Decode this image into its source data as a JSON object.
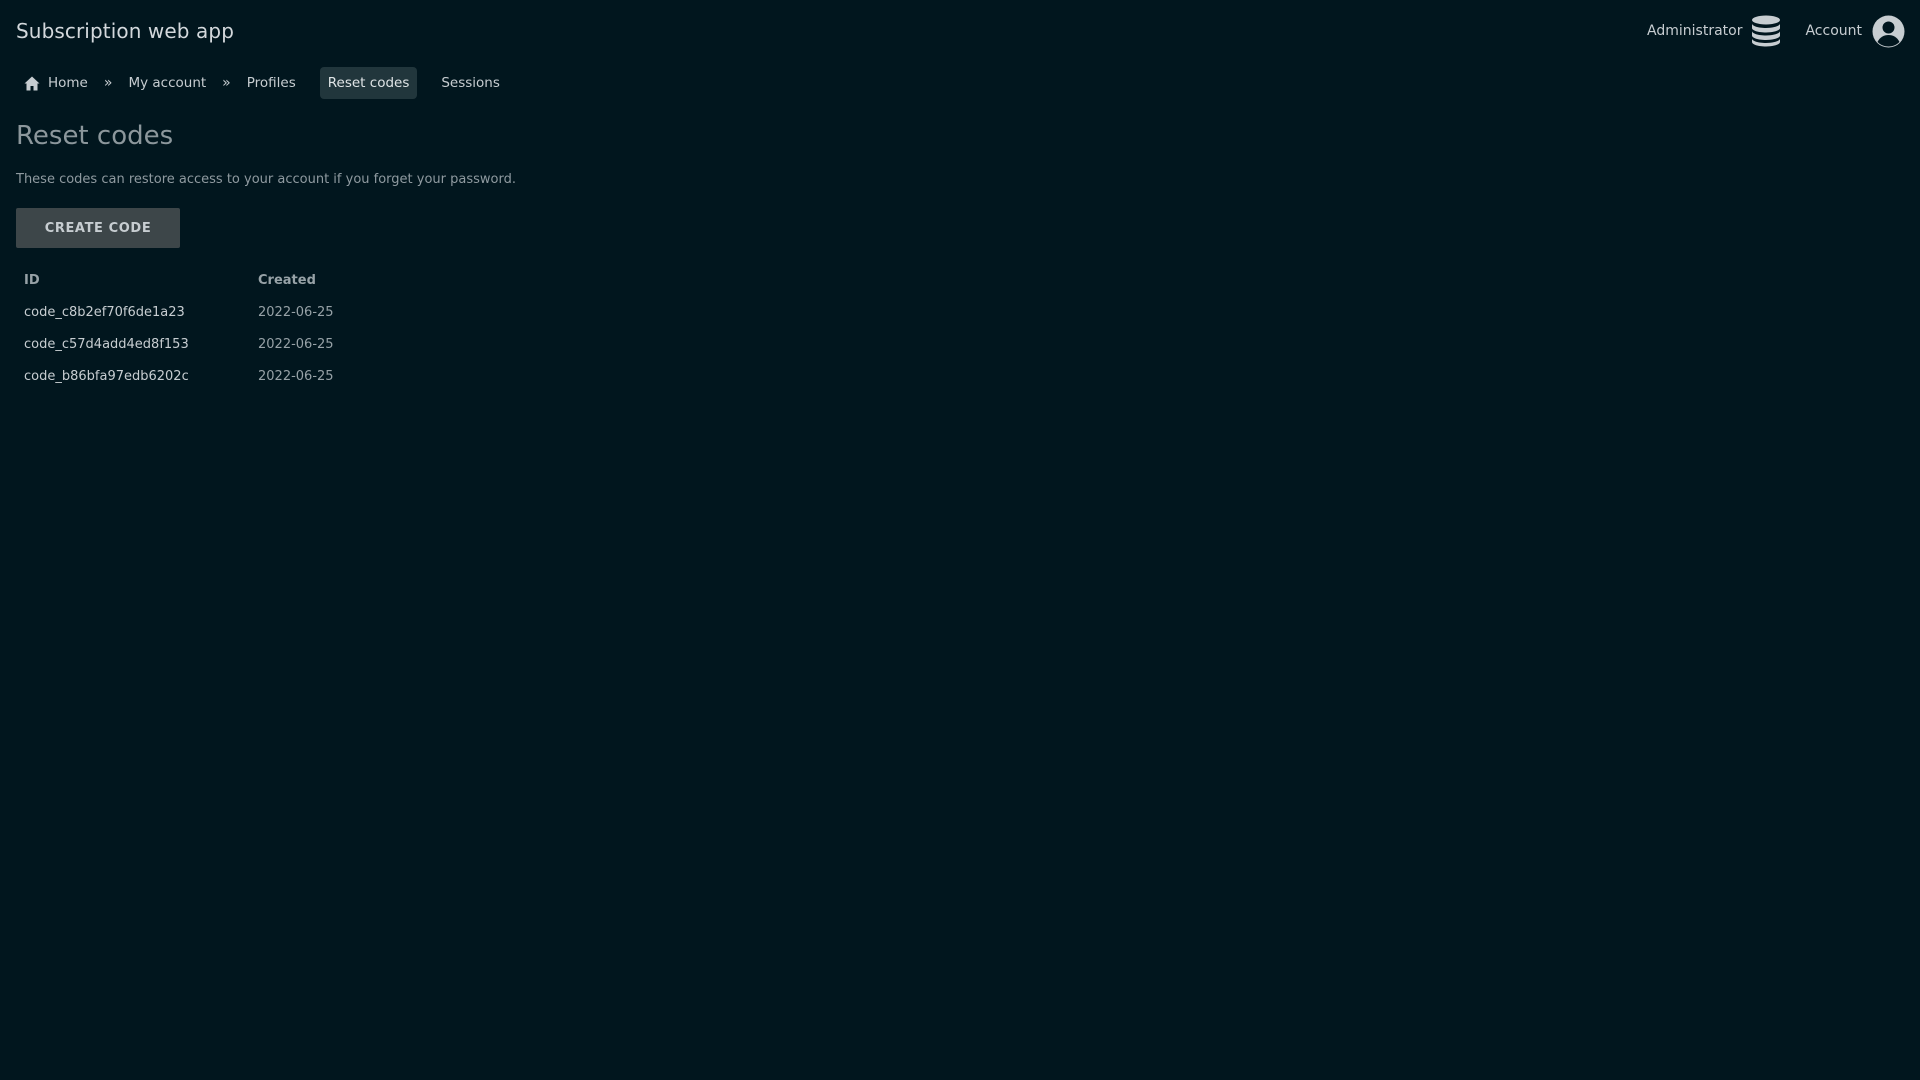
{
  "app": {
    "title": "Subscription web app"
  },
  "header": {
    "admin_label": "Administrator",
    "admin_icon": "database-icon",
    "account_label": "Account",
    "account_icon": "account-circle-icon"
  },
  "breadcrumb": {
    "home_icon": "home-icon",
    "items": [
      {
        "label": "Home"
      },
      {
        "label": "My account"
      },
      {
        "label": "Profiles"
      },
      {
        "label": "Reset codes",
        "active": true
      },
      {
        "label": "Sessions"
      }
    ],
    "separator": "»"
  },
  "main": {
    "title": "Reset codes",
    "description": "These codes can restore access to your account if you forget your password.",
    "create_button": "CREATE CODE",
    "table": {
      "columns": [
        "ID",
        "Created"
      ],
      "rows": [
        {
          "id": "code_c8b2ef70f6de1a23",
          "created": "2022-06-25"
        },
        {
          "id": "code_c57d4add4ed8f153",
          "created": "2022-06-25"
        },
        {
          "id": "code_b86bfa97edb6202c",
          "created": "2022-06-25"
        }
      ]
    }
  },
  "colors": {
    "background": "#01161e",
    "active_crumb_bg": "#21363c",
    "button_bg": "#3d4649",
    "text": "#c7cdd1"
  }
}
